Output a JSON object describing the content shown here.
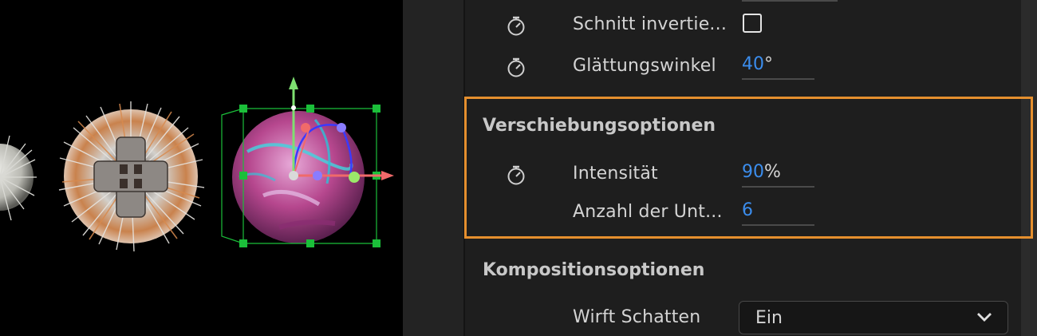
{
  "viewport": {
    "objects": [
      "white-spiky-sphere",
      "orange-spiky-sphere",
      "pink-rock-sphere"
    ],
    "colors": {
      "x_axis": "#f06a6a",
      "y_axis": "#7ee070",
      "z_axis": "#3a3aff",
      "bbox": "#1bbf3a"
    }
  },
  "panel": {
    "rows": [
      {
        "label": "Schnitt invertie...",
        "type": "checkbox",
        "checked": false
      },
      {
        "label": "Glättungswinkel",
        "value": "40",
        "unit": "°"
      }
    ],
    "sections": [
      {
        "title": "Verschiebungsoptionen",
        "rows": [
          {
            "label": "Intensität",
            "value": "90",
            "unit": "%"
          },
          {
            "label": "Anzahl der Unt...",
            "value": "6",
            "unit": ""
          }
        ]
      },
      {
        "title": "Kompositionsoptionen",
        "rows": [
          {
            "label": "Wirft Schatten",
            "type": "dropdown",
            "value": "Ein"
          }
        ]
      }
    ],
    "colors": {
      "value_blue": "#3b8ded",
      "highlight": "#e58f2e"
    }
  }
}
